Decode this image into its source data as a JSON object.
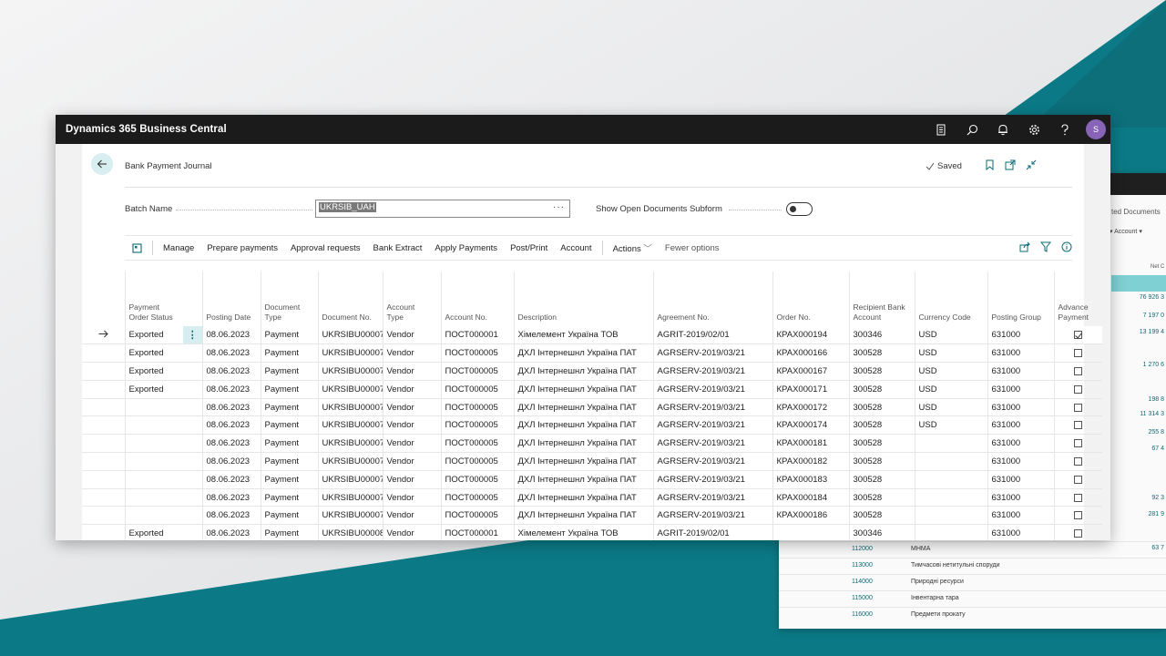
{
  "app": {
    "title": "Dynamics 365 Business Central",
    "avatar_initial": "S"
  },
  "topbar_icons": [
    "document-icon",
    "search-icon",
    "bell-icon",
    "gear-icon",
    "help-icon"
  ],
  "page": {
    "title": "Bank Payment Journal",
    "saved_label": "Saved"
  },
  "fields": {
    "batch_name_label": "Batch Name",
    "batch_name_value": "UKRSIB_UAH",
    "batch_name_ellipsis": "···",
    "show_open_docs_label": "Show Open Documents Subform",
    "show_open_docs_on": false
  },
  "actions": {
    "manage": "Manage",
    "prepare_payments": "Prepare payments",
    "approval_requests": "Approval requests",
    "bank_extract": "Bank Extract",
    "apply_payments": "Apply Payments",
    "post_print": "Post/Print",
    "account": "Account",
    "actions": "Actions",
    "fewer_options": "Fewer options"
  },
  "columns": {
    "status_l1": "Payment",
    "status_l2": "Order Status",
    "posting_date": "Posting Date",
    "doc_type_l1": "Document",
    "doc_type_l2": "Type",
    "doc_no": "Document No.",
    "acc_type_l1": "Account",
    "acc_type_l2": "Type",
    "acc_no": "Account No.",
    "description": "Description",
    "agreement_no": "Agreement No.",
    "order_no": "Order No.",
    "recipient_l1": "Recipient Bank",
    "recipient_l2": "Account",
    "currency": "Currency Code",
    "posting_group": "Posting Group",
    "advance_l1": "Advance",
    "advance_l2": "Payment"
  },
  "rows": [
    {
      "status": "Exported",
      "date": "08.06.2023",
      "doc_type": "Payment",
      "doc_no": "UKRSIBU00007",
      "acc_type": "Vendor",
      "acc_no": "ПОСТ000001",
      "desc": "Хімелемент Україна ТОВ",
      "agreement": "AGRIT-2019/02/01",
      "order": "КРАХ000194",
      "recipient": "300346",
      "currency": "USD",
      "group": "631000",
      "advance": true
    },
    {
      "status": "Exported",
      "date": "08.06.2023",
      "doc_type": "Payment",
      "doc_no": "UKRSIBU00007",
      "acc_type": "Vendor",
      "acc_no": "ПОСТ000005",
      "desc": "ДХЛ Інтернешнл Україна ПАТ",
      "agreement": "AGRSERV-2019/03/21",
      "order": "КРАХ000166",
      "recipient": "300528",
      "currency": "USD",
      "group": "631000",
      "advance": false
    },
    {
      "status": "Exported",
      "date": "08.06.2023",
      "doc_type": "Payment",
      "doc_no": "UKRSIBU00007",
      "acc_type": "Vendor",
      "acc_no": "ПОСТ000005",
      "desc": "ДХЛ Інтернешнл Україна ПАТ",
      "agreement": "AGRSERV-2019/03/21",
      "order": "КРАХ000167",
      "recipient": "300528",
      "currency": "USD",
      "group": "631000",
      "advance": false
    },
    {
      "status": "Exported",
      "date": "08.06.2023",
      "doc_type": "Payment",
      "doc_no": "UKRSIBU00007",
      "acc_type": "Vendor",
      "acc_no": "ПОСТ000005",
      "desc": "ДХЛ Інтернешнл Україна ПАТ",
      "agreement": "AGRSERV-2019/03/21",
      "order": "КРАХ000171",
      "recipient": "300528",
      "currency": "USD",
      "group": "631000",
      "advance": false
    },
    {
      "status": "",
      "date": "08.06.2023",
      "doc_type": "Payment",
      "doc_no": "UKRSIBU00007",
      "acc_type": "Vendor",
      "acc_no": "ПОСТ000005",
      "desc": "ДХЛ Інтернешнл Україна ПАТ",
      "agreement": "AGRSERV-2019/03/21",
      "order": "КРАХ000172",
      "recipient": "300528",
      "currency": "USD",
      "group": "631000",
      "advance": false
    },
    {
      "status": "",
      "date": "08.06.2023",
      "doc_type": "Payment",
      "doc_no": "UKRSIBU00007",
      "acc_type": "Vendor",
      "acc_no": "ПОСТ000005",
      "desc": "ДХЛ Інтернешнл Україна ПАТ",
      "agreement": "AGRSERV-2019/03/21",
      "order": "КРАХ000174",
      "recipient": "300528",
      "currency": "USD",
      "group": "631000",
      "advance": false
    },
    {
      "status": "",
      "date": "08.06.2023",
      "doc_type": "Payment",
      "doc_no": "UKRSIBU00007",
      "acc_type": "Vendor",
      "acc_no": "ПОСТ000005",
      "desc": "ДХЛ Інтернешнл Україна ПАТ",
      "agreement": "AGRSERV-2019/03/21",
      "order": "КРАХ000181",
      "recipient": "300528",
      "currency": "",
      "group": "631000",
      "advance": false
    },
    {
      "status": "",
      "date": "08.06.2023",
      "doc_type": "Payment",
      "doc_no": "UKRSIBU00007",
      "acc_type": "Vendor",
      "acc_no": "ПОСТ000005",
      "desc": "ДХЛ Інтернешнл Україна ПАТ",
      "agreement": "AGRSERV-2019/03/21",
      "order": "КРАХ000182",
      "recipient": "300528",
      "currency": "",
      "group": "631000",
      "advance": false
    },
    {
      "status": "",
      "date": "08.06.2023",
      "doc_type": "Payment",
      "doc_no": "UKRSIBU00007",
      "acc_type": "Vendor",
      "acc_no": "ПОСТ000005",
      "desc": "ДХЛ Інтернешнл Україна ПАТ",
      "agreement": "AGRSERV-2019/03/21",
      "order": "КРАХ000183",
      "recipient": "300528",
      "currency": "",
      "group": "631000",
      "advance": false
    },
    {
      "status": "",
      "date": "08.06.2023",
      "doc_type": "Payment",
      "doc_no": "UKRSIBU00007",
      "acc_type": "Vendor",
      "acc_no": "ПОСТ000005",
      "desc": "ДХЛ Інтернешнл Україна ПАТ",
      "agreement": "AGRSERV-2019/03/21",
      "order": "КРАХ000184",
      "recipient": "300528",
      "currency": "",
      "group": "631000",
      "advance": false
    },
    {
      "status": "",
      "date": "08.06.2023",
      "doc_type": "Payment",
      "doc_no": "UKRSIBU00007",
      "acc_type": "Vendor",
      "acc_no": "ПОСТ000005",
      "desc": "ДХЛ Інтернешнл Україна ПАТ",
      "agreement": "AGRSERV-2019/03/21",
      "order": "КРАХ000186",
      "recipient": "300528",
      "currency": "",
      "group": "631000",
      "advance": false
    },
    {
      "status": "Exported",
      "date": "08.06.2023",
      "doc_type": "Payment",
      "doc_no": "UKRSIBU00008",
      "acc_type": "Vendor",
      "acc_no": "ПОСТ000001",
      "desc": "Хімелемент Україна ТОВ",
      "agreement": "AGRIT-2019/02/01",
      "order": "",
      "recipient": "300346",
      "currency": "",
      "group": "631000",
      "advance": false
    }
  ],
  "background_window": {
    "header": "ted Documents",
    "account_label": "Account",
    "net_label": "Net C",
    "numbers": [
      "76 926 3",
      "7 197 0",
      "13 199 4",
      "1 270 6",
      "198 8",
      "11 314 3",
      "255 8",
      "67 4",
      "92 3",
      "281 9",
      "63 7"
    ],
    "rows": [
      {
        "code": "112000",
        "name": "МНМА"
      },
      {
        "code": "113000",
        "name": "Тимчасові нетитульні споруди"
      },
      {
        "code": "114000",
        "name": "Природні ресурси"
      },
      {
        "code": "115000",
        "name": "Інвентарна тара"
      },
      {
        "code": "116000",
        "name": "Предмети прокату"
      }
    ]
  },
  "colors": {
    "teal": "#0b7a86",
    "topbar": "#1b1b1b",
    "avatar": "#8764b8",
    "accent_light": "#d6eef0"
  }
}
